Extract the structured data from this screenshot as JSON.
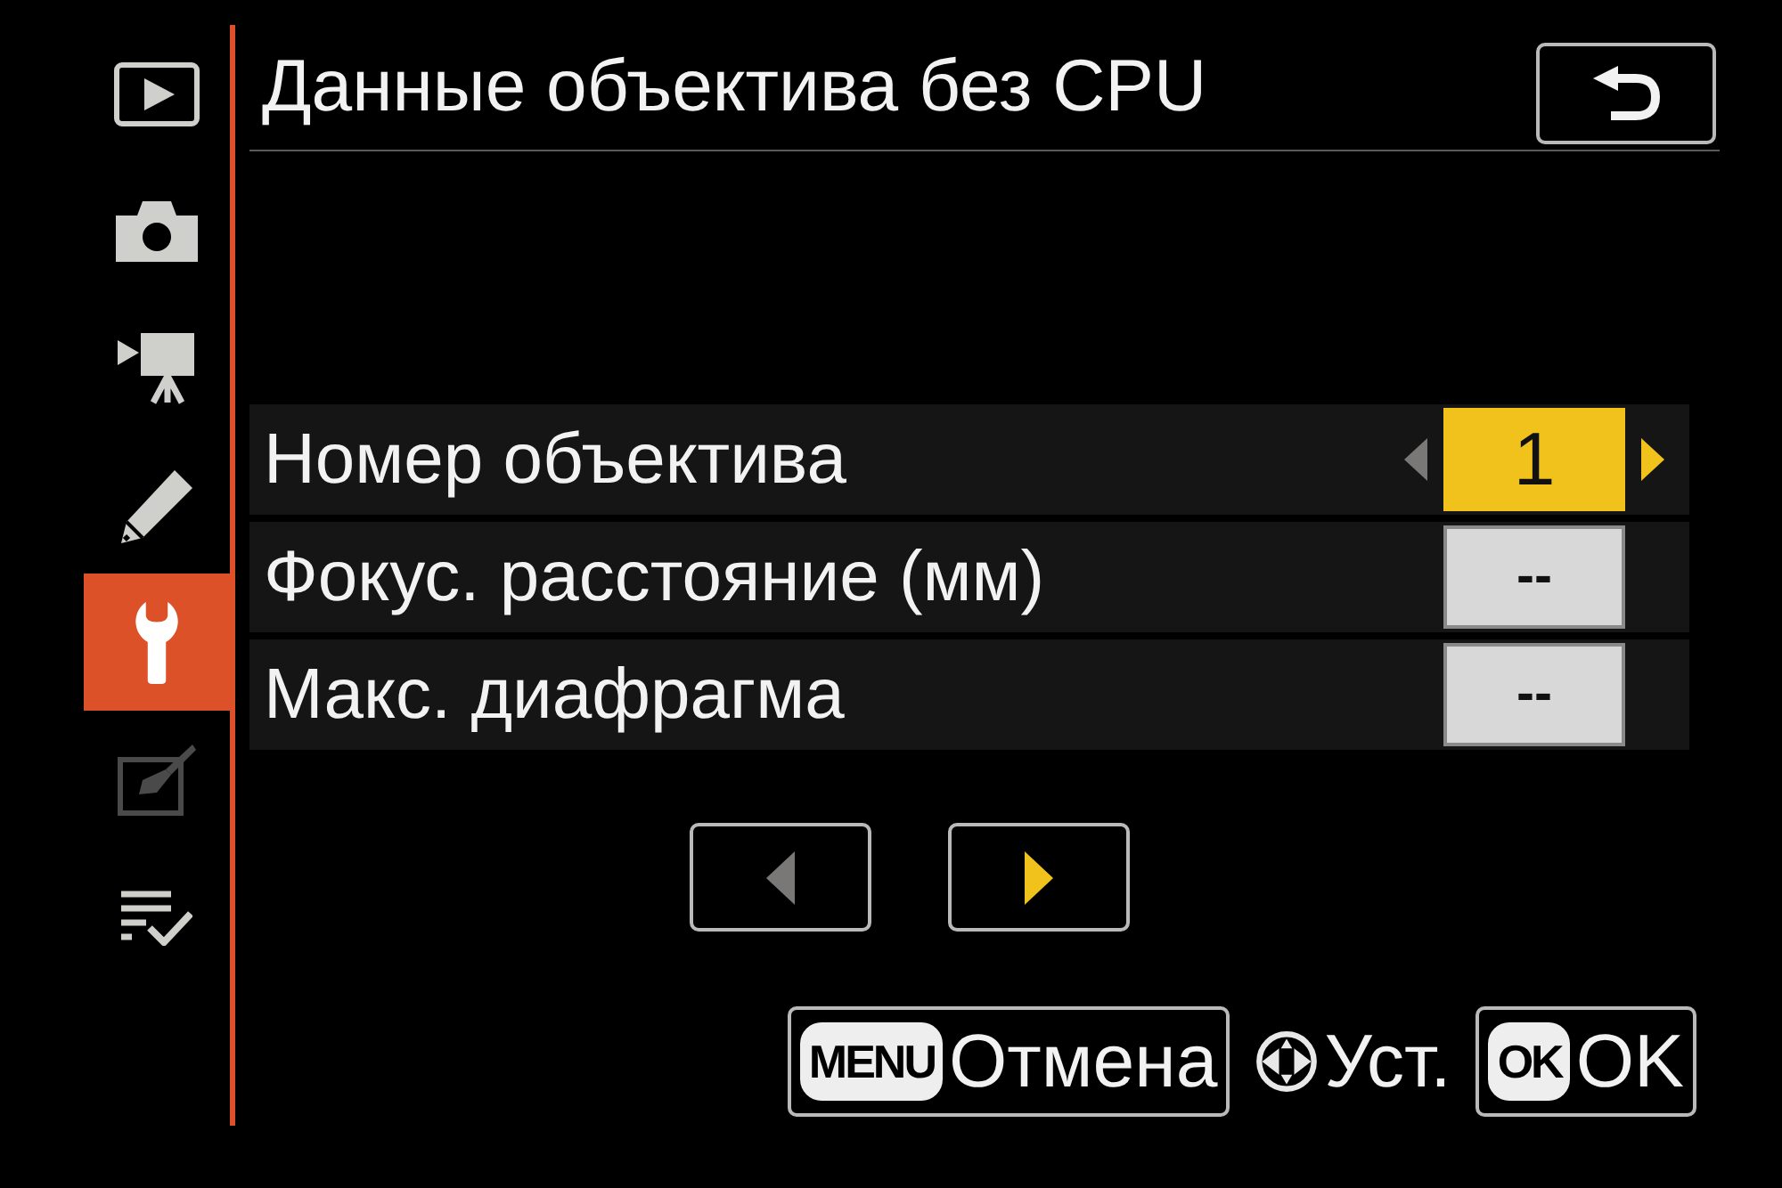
{
  "sidebar": {
    "items": [
      {
        "kind": "playback",
        "selected": false,
        "disabled": false
      },
      {
        "kind": "photo",
        "selected": false,
        "disabled": false
      },
      {
        "kind": "movie",
        "selected": false,
        "disabled": false
      },
      {
        "kind": "custom",
        "selected": false,
        "disabled": false
      },
      {
        "kind": "setup",
        "selected": true,
        "disabled": false
      },
      {
        "kind": "retouch",
        "selected": false,
        "disabled": true
      },
      {
        "kind": "mymenu",
        "selected": false,
        "disabled": false
      }
    ]
  },
  "title": "Данные объектива без CPU",
  "rows": [
    {
      "label": "Номер объектива",
      "value": "1",
      "selected": true
    },
    {
      "label": "Фокус. расстояние (мм)",
      "value": "--",
      "selected": false
    },
    {
      "label": "Макс. диафрагма",
      "value": "--",
      "selected": false
    }
  ],
  "value_stepper": {
    "prev_disabled": true,
    "next_disabled": false
  },
  "pager": [
    {
      "kind": "prev",
      "disabled": true
    },
    {
      "kind": "next",
      "disabled": false
    }
  ],
  "footer": [
    {
      "kind": "button",
      "key": "MENU",
      "label": "Отмена"
    },
    {
      "kind": "hint",
      "label": "Уст."
    },
    {
      "kind": "button",
      "key": "OK",
      "label": "OK"
    }
  ]
}
